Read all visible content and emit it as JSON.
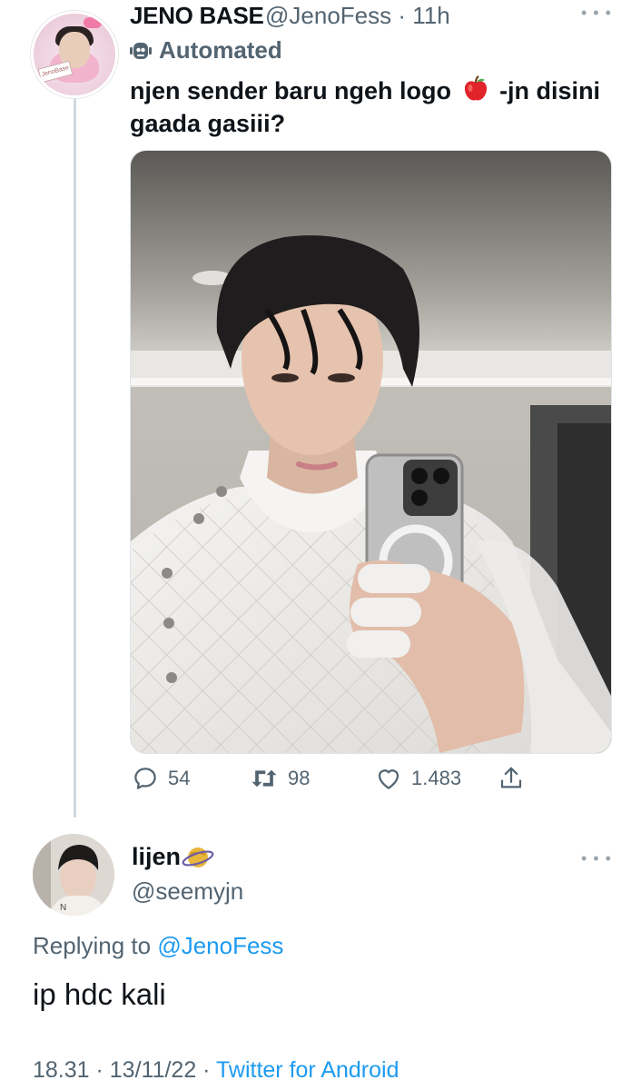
{
  "tweet": {
    "author_name": "JENO BASE",
    "handle": "@JenoFess",
    "time": "· 11h",
    "automated_label": "Automated",
    "text_before": "njen sender baru ngeh logo",
    "text_after": " -jn disini gaada gasiii?",
    "stats": {
      "replies": "54",
      "retweets": "98",
      "likes": "1.483"
    }
  },
  "reply": {
    "author_name": "lijen",
    "handle": "@seemyjn",
    "replying_prefix": "Replying to ",
    "replying_to": "@JenoFess",
    "text": "ip hdc kali",
    "timestamp": "18.31 · 13/11/22 · ",
    "source": "Twitter for Android"
  },
  "colors": {
    "text_primary": "#0f1419",
    "text_secondary": "#536471",
    "accent": "#1d9bf0",
    "thread_line": "#cfd9de"
  },
  "icons": {
    "reply": "comment-icon",
    "retweet": "retweet-icon",
    "like": "heart-icon",
    "share": "share-icon",
    "automated": "robot-icon",
    "emoji": "red-apple-emoji",
    "badge": "ringed-planet-emoji"
  }
}
